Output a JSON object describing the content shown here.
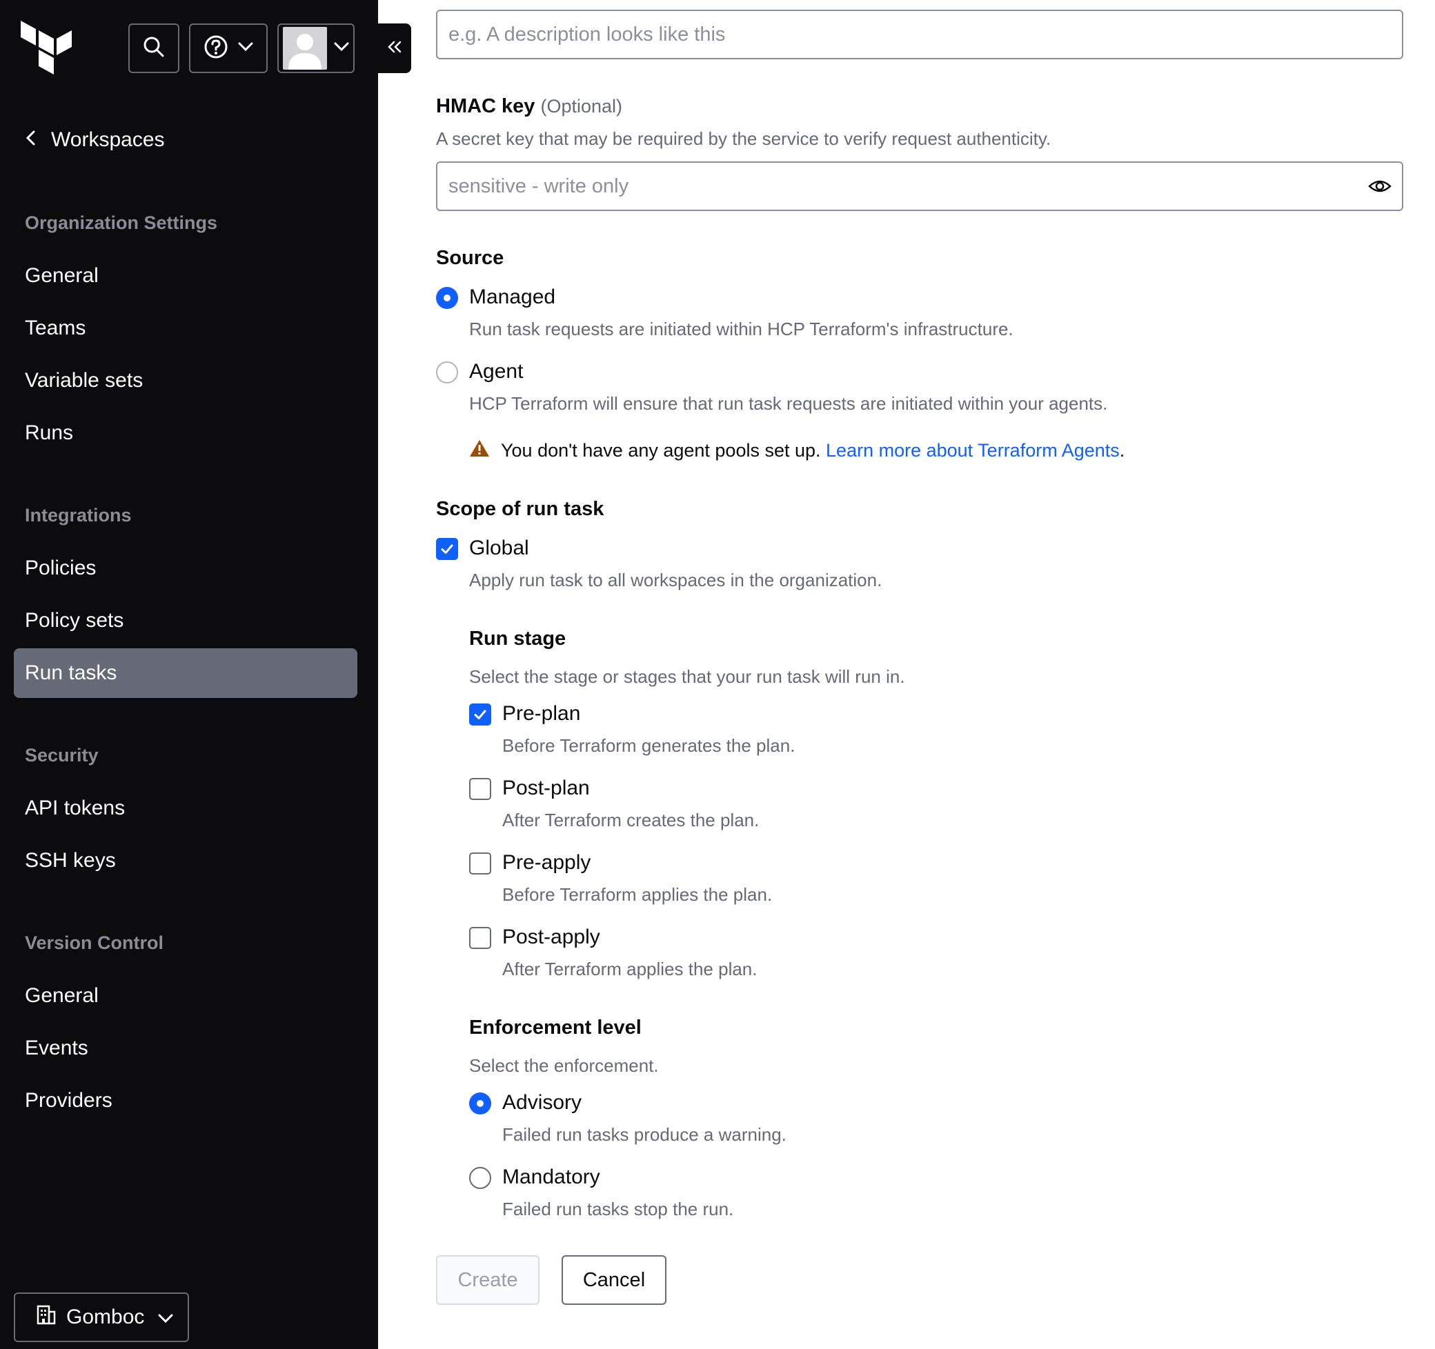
{
  "sidebar": {
    "back_label": "Workspaces",
    "sections": {
      "organization": "Organization Settings",
      "integrations": "Integrations",
      "security": "Security",
      "version_control": "Version Control"
    },
    "items": {
      "general": "General",
      "teams": "Teams",
      "variable_sets": "Variable sets",
      "runs": "Runs",
      "policies": "Policies",
      "policy_sets": "Policy sets",
      "run_tasks": "Run tasks",
      "api_tokens": "API tokens",
      "ssh_keys": "SSH keys",
      "vc_general": "General",
      "events": "Events",
      "providers": "Providers"
    },
    "active_item": "Run tasks",
    "org_switcher": "Gomboc"
  },
  "form": {
    "description": {
      "placeholder": "e.g. A description looks like this",
      "value": ""
    },
    "hmac": {
      "label": "HMAC key",
      "optional": "(Optional)",
      "help": "A secret key that may be required by the service to verify request authenticity.",
      "placeholder": "sensitive - write only"
    },
    "source": {
      "title": "Source",
      "managed_label": "Managed",
      "managed_help": "Run task requests are initiated within HCP Terraform's infrastructure.",
      "agent_label": "Agent",
      "agent_help": "HCP Terraform will ensure that run task requests are initiated within your agents.",
      "warning_text": "You don't have any agent pools set up. ",
      "warning_link": "Learn more about Terraform Agents",
      "warning_end": ".",
      "selected": "Managed"
    },
    "scope": {
      "title": "Scope of run task",
      "global_label": "Global",
      "global_help": "Apply run task to all workspaces in the organization.",
      "global_checked": true
    },
    "run_stage": {
      "title": "Run stage",
      "help": "Select the stage or stages that your run task will run in.",
      "pre_plan": "Pre-plan",
      "pre_plan_help": "Before Terraform generates the plan.",
      "post_plan": "Post-plan",
      "post_plan_help": "After Terraform creates the plan.",
      "pre_apply": "Pre-apply",
      "pre_apply_help": "Before Terraform applies the plan.",
      "post_apply": "Post-apply",
      "post_apply_help": "After Terraform applies the plan.",
      "checked": [
        "Pre-plan"
      ]
    },
    "enforcement": {
      "title": "Enforcement level",
      "help": "Select the enforcement.",
      "advisory": "Advisory",
      "advisory_help": "Failed run tasks produce a warning.",
      "mandatory": "Mandatory",
      "mandatory_help": "Failed run tasks stop the run.",
      "selected": "Advisory"
    },
    "buttons": {
      "create": "Create",
      "cancel": "Cancel"
    }
  },
  "colors": {
    "sidebar_bg": "#0c0c0e",
    "active_item_bg": "#656a76",
    "accent": "#1060ff",
    "warning": "#9e4b00"
  }
}
